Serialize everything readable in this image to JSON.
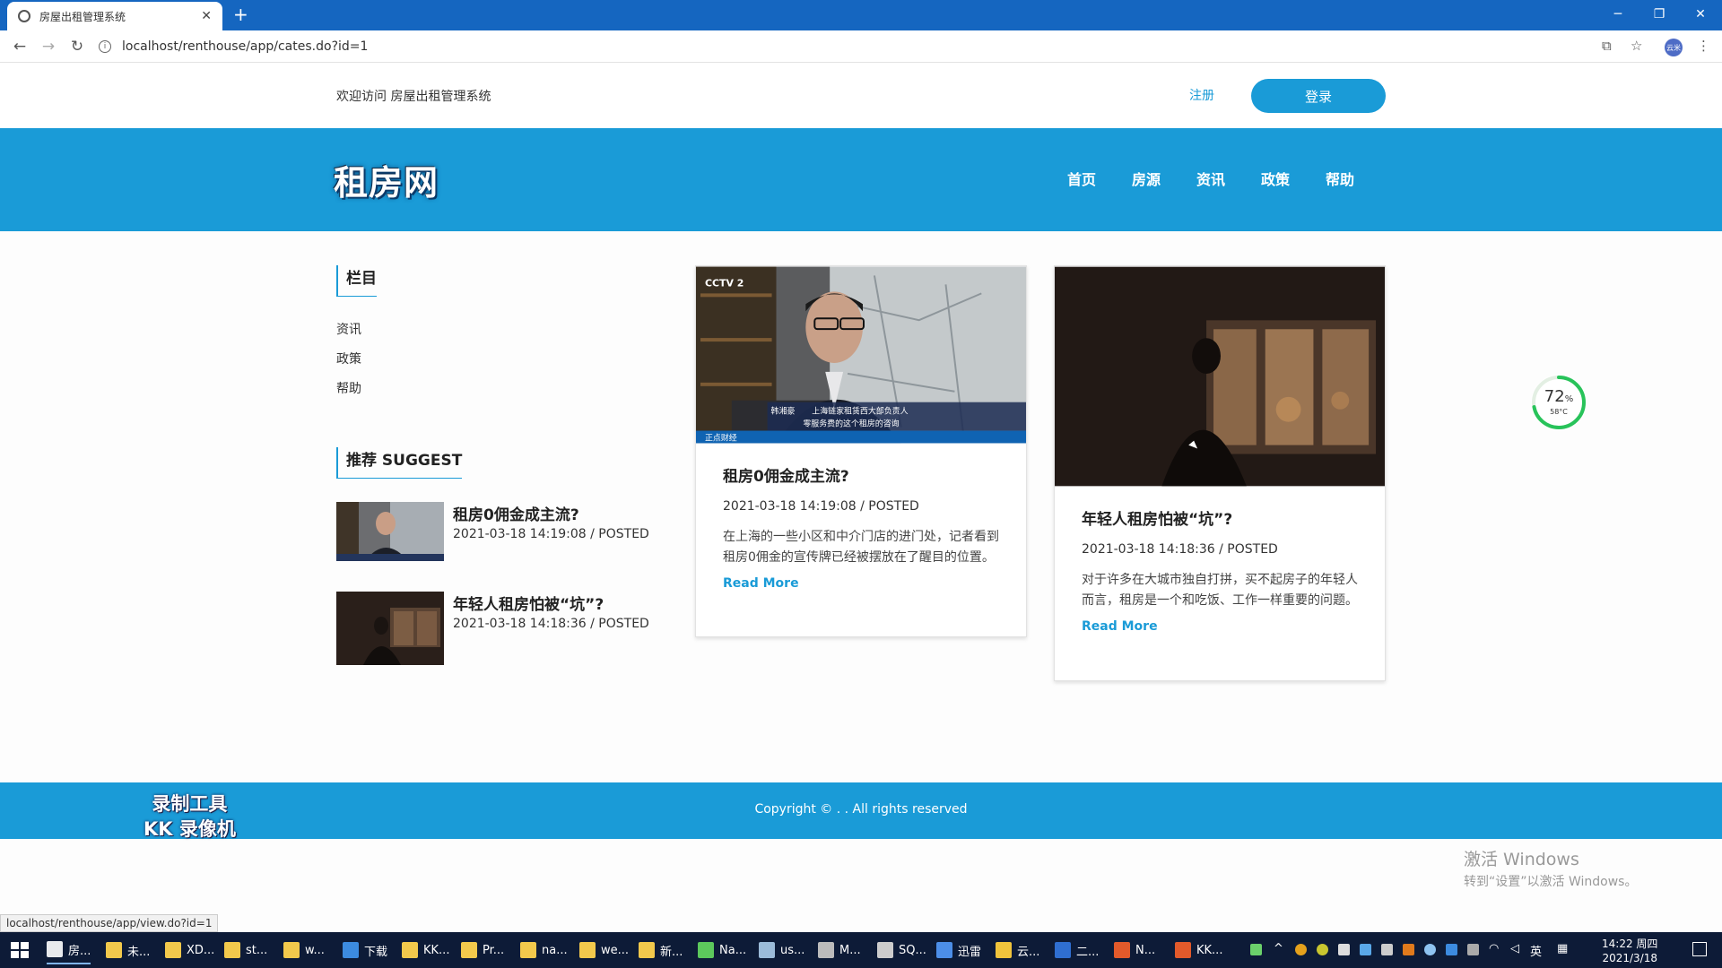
{
  "browser": {
    "tab_title": "房屋出租管理系统",
    "url": "localhost/renthouse/app/cates.do?id=1",
    "status_url": "localhost/renthouse/app/view.do?id=1",
    "profile_label": "云米"
  },
  "topbar": {
    "welcome": "欢迎访问 房屋出租管理系统",
    "register": "注册",
    "login": "登录"
  },
  "header": {
    "logo": "租房网",
    "nav": [
      "首页",
      "房源",
      "资讯",
      "政策",
      "帮助"
    ]
  },
  "sidebar": {
    "category_heading": "栏目",
    "categories": [
      "资讯",
      "政策",
      "帮助"
    ],
    "suggest_heading": "推荐 SUGGEST",
    "suggest": [
      {
        "title": "租房0佣金成主流?",
        "date": "2021-03-18 14:19:08 / POSTED"
      },
      {
        "title": "年轻人租房怕被“坑”?",
        "date": "2021-03-18 14:18:36 / POSTED"
      }
    ]
  },
  "cards": [
    {
      "title": "租房0佣金成主流?",
      "date": "2021-03-18 14:19:08 / POSTED",
      "excerpt": "在上海的一些小区和中介门店的进门处，记者看到租房0佣金的宣传牌已经被摆放在了醒目的位置。",
      "more": "Read More",
      "image_caption_1": "韩湘豪",
      "image_caption_2": "上海链家租赁西大部负责人",
      "image_caption_3": "零服务费的这个租房的咨询",
      "image_channel": "CCTV 2",
      "image_program": "正点财经"
    },
    {
      "title": "年轻人租房怕被“坑”?",
      "date": "2021-03-18 14:18:36 / POSTED",
      "excerpt": "对于许多在大城市独自打拼，买不起房子的年轻人而言，租房是一个和吃饭、工作一样重要的问题。",
      "more": "Read More"
    }
  ],
  "gauge": {
    "percent": "72",
    "percent_unit": "%",
    "temp": "58°C",
    "level": 0.72
  },
  "footer": {
    "copyright": "Copyright © . . All rights reserved",
    "watermark_line1": "录制工具",
    "watermark_line2": "KK 录像机"
  },
  "windows": {
    "activate_title": "激活 Windows",
    "activate_sub": "转到“设置”以激活 Windows。"
  },
  "taskbar": {
    "apps": [
      "房...",
      "未...",
      "XD...",
      "st...",
      "w...",
      "下载",
      "KK...",
      "Pr...",
      "na...",
      "we...",
      "新...",
      "Na...",
      "us...",
      "M...",
      "SQ...",
      "迅雷",
      "云...",
      "二...",
      "N...",
      "KK..."
    ],
    "ime": "英",
    "time": "14:22 周四",
    "date": "2021/3/18"
  },
  "colors": {
    "brand": "#1a9bd7",
    "taskbar": "#0d1b37",
    "chrome": "#1566c0"
  }
}
